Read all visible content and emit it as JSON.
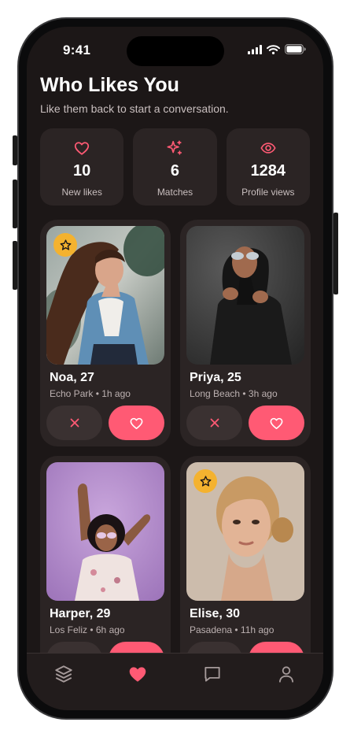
{
  "status": {
    "time": "9:41"
  },
  "header": {
    "title": "Who Likes You",
    "subtitle": "Like them back to start a conversation."
  },
  "stats": [
    {
      "icon": "heart-outline-icon",
      "value": "10",
      "label": "New likes"
    },
    {
      "icon": "sparkle-icon",
      "value": "6",
      "label": "Matches"
    },
    {
      "icon": "eye-icon",
      "value": "1284",
      "label": "Profile views"
    }
  ],
  "profiles": [
    {
      "name": "Noa, 27",
      "meta": "Echo Park • 1h ago",
      "starred": true
    },
    {
      "name": "Priya, 25",
      "meta": "Long Beach • 3h ago",
      "starred": false
    },
    {
      "name": "Harper, 29",
      "meta": "Los Feliz • 6h ago",
      "starred": false
    },
    {
      "name": "Elise, 30",
      "meta": "Pasadena • 11h ago",
      "starred": true
    }
  ],
  "tabs": [
    {
      "icon": "stack-icon",
      "active": false
    },
    {
      "icon": "heart-filled-icon",
      "active": true
    },
    {
      "icon": "chat-icon",
      "active": false
    },
    {
      "icon": "user-icon",
      "active": false
    }
  ],
  "colors": {
    "accent": "#ff5a74",
    "background": "#1c1717",
    "card": "#2b2424",
    "star": "#f4b22f"
  }
}
